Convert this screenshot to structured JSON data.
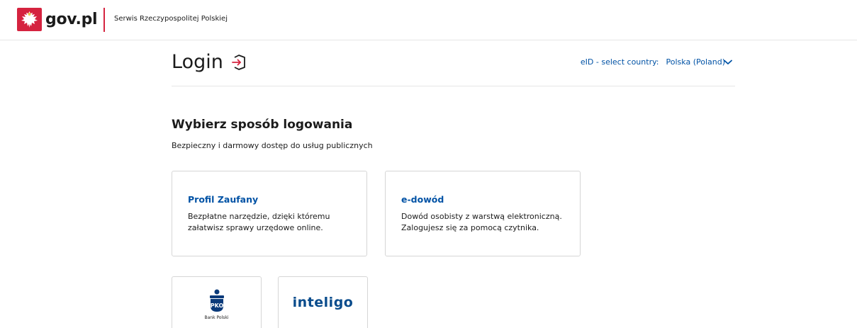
{
  "header": {
    "brand_text": "gov.pl",
    "service_name": "Serwis Rzeczypospolitej Polskiej",
    "emblem_icon": "polish-eagle-emblem-icon",
    "accent_color": "#d5233f"
  },
  "login": {
    "title": "Login",
    "icon": "login-arrow-icon"
  },
  "eid": {
    "label": "eID - select country:",
    "selected": "Polska (Poland)",
    "icon": "chevron-down-icon"
  },
  "main": {
    "heading": "Wybierz sposób logowania",
    "subheading": "Bezpieczny i darmowy dostęp do usług publicznych"
  },
  "methods": [
    {
      "title": "Profil Zaufany",
      "description_line1": "Bezpłatne narzędzie, dzięki któremu",
      "description_line2": "załatwisz sprawy urzędowe online."
    },
    {
      "title": "e-dowód",
      "description_line1": "Dowód osobisty z warstwą elektroniczną.",
      "description_line2": "Zalogujesz się za pomocą czytnika."
    }
  ],
  "banks": [
    {
      "name": "Bank Polski",
      "logo": "pko-bank-polski-logo"
    },
    {
      "name": "inteligo",
      "logo": "inteligo-logo"
    }
  ],
  "colors": {
    "link_blue": "#0052a5",
    "text": "#1b1b1b",
    "border": "#d6d6d6"
  }
}
